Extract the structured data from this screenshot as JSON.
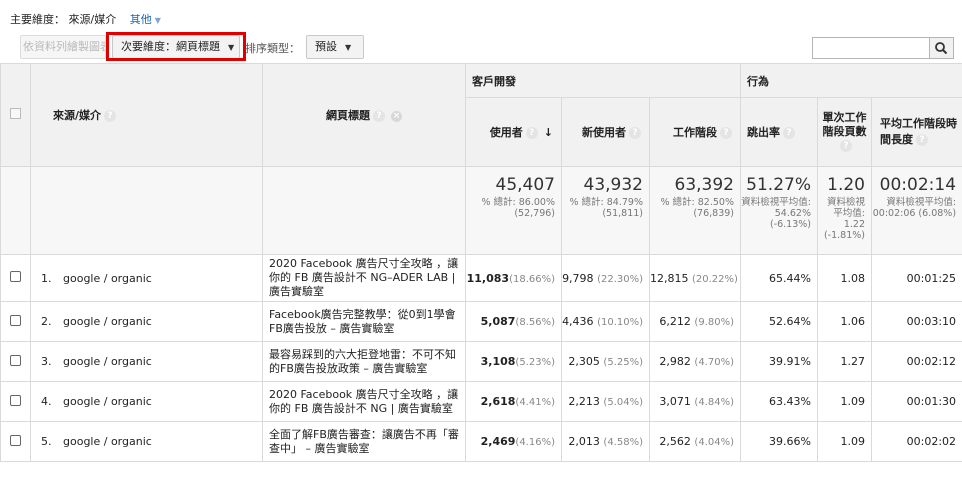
{
  "dims": {
    "primary_label": "主要維度：",
    "primary_value": "來源/媒介",
    "other": "其他"
  },
  "toolbar": {
    "plot_rows": "依資料列繪製圖表",
    "secondary_dim": "次要維度：網頁標題",
    "sort_label": "排序類型：",
    "sort_value": "預設",
    "search_placeholder": ""
  },
  "table": {
    "group_acquisition": "客戶開發",
    "group_behavior": "行為",
    "col_source": "來源/媒介",
    "col_title": "網頁標題",
    "col_users": "使用者",
    "col_new_users": "新使用者",
    "col_sessions": "工作階段",
    "col_bounce": "跳出率",
    "col_pages": "單次工作階段頁數",
    "col_duration": "平均工作階段時間長度",
    "totals": {
      "users": "45,407",
      "users_sub": "% 總計: 86.00% (52,796)",
      "new_users": "43,932",
      "new_users_sub": "% 總計: 84.79% (51,811)",
      "sessions": "63,392",
      "sessions_sub": "% 總計: 82.50% (76,839)",
      "bounce": "51.27%",
      "bounce_sub": "資料檢視平均值: 54.62% (-6.13%)",
      "pages": "1.20",
      "pages_sub": "資料檢視平均值: 1.22 (-1.81%)",
      "duration": "00:02:14",
      "duration_sub": "資料檢視平均值: 00:02:06 (6.08%)"
    },
    "rows": [
      {
        "idx": "1.",
        "source": "google / organic",
        "title": "2020 Facebook 廣告尺寸全攻略 ，讓你的 FB 廣告設計不 NG–ADER LAB | 廣告實驗室",
        "users": "11,083",
        "users_pct": "(18.66%)",
        "new_users": "9,798",
        "new_users_pct": "(22.30%)",
        "sessions": "12,815",
        "sessions_pct": "(20.22%)",
        "bounce": "65.44%",
        "pages": "1.08",
        "duration": "00:01:25"
      },
      {
        "idx": "2.",
        "source": "google / organic",
        "title": "Facebook廣告完整教學：從0到1學會FB廣告投放 – 廣告實驗室",
        "users": "5,087",
        "users_pct": "(8.56%)",
        "new_users": "4,436",
        "new_users_pct": "(10.10%)",
        "sessions": "6,212",
        "sessions_pct": "(9.80%)",
        "bounce": "52.64%",
        "pages": "1.06",
        "duration": "00:03:10"
      },
      {
        "idx": "3.",
        "source": "google / organic",
        "title": "最容易踩到的六大拒登地雷：不可不知的FB廣告投放政策 – 廣告實驗室",
        "users": "3,108",
        "users_pct": "(5.23%)",
        "new_users": "2,305",
        "new_users_pct": "(5.25%)",
        "sessions": "2,982",
        "sessions_pct": "(4.70%)",
        "bounce": "39.91%",
        "pages": "1.27",
        "duration": "00:02:12"
      },
      {
        "idx": "4.",
        "source": "google / organic",
        "title": "2020 Facebook 廣告尺寸全攻略 ，讓你的 FB 廣告設計不 NG | 廣告實驗室",
        "users": "2,618",
        "users_pct": "(4.41%)",
        "new_users": "2,213",
        "new_users_pct": "(5.04%)",
        "sessions": "3,071",
        "sessions_pct": "(4.84%)",
        "bounce": "63.43%",
        "pages": "1.09",
        "duration": "00:01:30"
      },
      {
        "idx": "5.",
        "source": "google / organic",
        "title": "全面了解FB廣告審查：讓廣告不再「審查中」 – 廣告實驗室",
        "users": "2,469",
        "users_pct": "(4.16%)",
        "new_users": "2,013",
        "new_users_pct": "(4.58%)",
        "sessions": "2,562",
        "sessions_pct": "(4.04%)",
        "bounce": "39.66%",
        "pages": "1.09",
        "duration": "00:02:02"
      }
    ]
  },
  "colors": {
    "highlight": "#e00000",
    "link": "#1a67b1"
  }
}
